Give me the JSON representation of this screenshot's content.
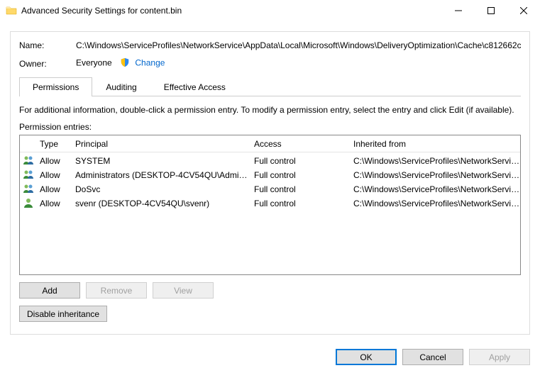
{
  "window": {
    "title": "Advanced Security Settings for content.bin"
  },
  "labels": {
    "name": "Name:",
    "owner": "Owner:"
  },
  "values": {
    "name_path": "C:\\Windows\\ServiceProfiles\\NetworkService\\AppData\\Local\\Microsoft\\Windows\\DeliveryOptimization\\Cache\\c812662c",
    "owner": "Everyone",
    "change": "Change"
  },
  "tabs": {
    "permissions": "Permissions",
    "auditing": "Auditing",
    "effective": "Effective Access"
  },
  "instructions": "For additional information, double-click a permission entry. To modify a permission entry, select the entry and click Edit (if available).",
  "entries_label": "Permission entries:",
  "columns": {
    "type": "Type",
    "principal": "Principal",
    "access": "Access",
    "inherited": "Inherited from"
  },
  "rows": [
    {
      "icon": "group",
      "type": "Allow",
      "principal": "SYSTEM",
      "access": "Full control",
      "inherited": "C:\\Windows\\ServiceProfiles\\NetworkService..."
    },
    {
      "icon": "group",
      "type": "Allow",
      "principal": "Administrators (DESKTOP-4CV54QU\\Admin...",
      "access": "Full control",
      "inherited": "C:\\Windows\\ServiceProfiles\\NetworkService..."
    },
    {
      "icon": "group",
      "type": "Allow",
      "principal": "DoSvc",
      "access": "Full control",
      "inherited": "C:\\Windows\\ServiceProfiles\\NetworkService..."
    },
    {
      "icon": "user",
      "type": "Allow",
      "principal": "svenr (DESKTOP-4CV54QU\\svenr)",
      "access": "Full control",
      "inherited": "C:\\Windows\\ServiceProfiles\\NetworkService..."
    }
  ],
  "buttons": {
    "add": "Add",
    "remove": "Remove",
    "view": "View",
    "disable_inherit": "Disable inheritance",
    "ok": "OK",
    "cancel": "Cancel",
    "apply": "Apply"
  }
}
